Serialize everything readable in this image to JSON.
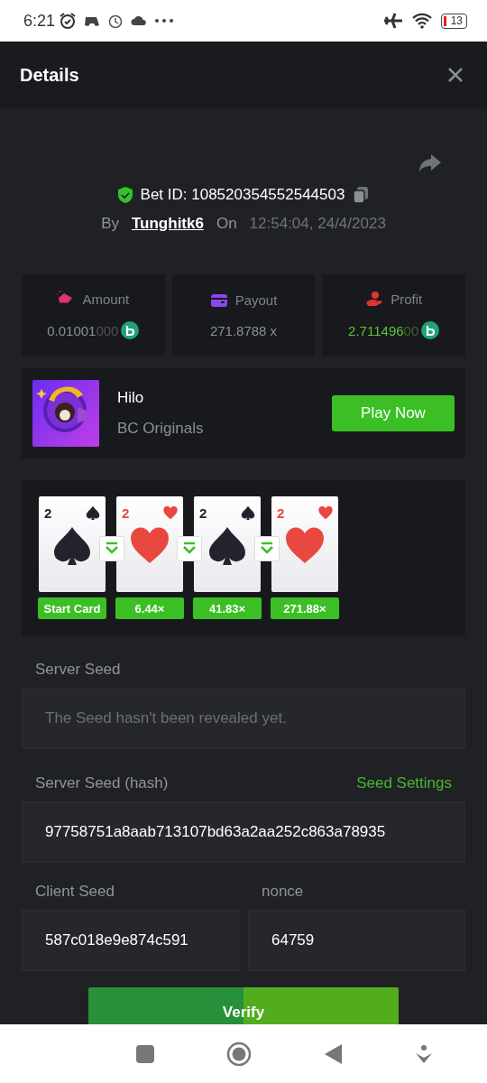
{
  "status_bar": {
    "time": "6:21",
    "battery": "13"
  },
  "header": {
    "title": "Details"
  },
  "bet": {
    "id_label": "Bet ID: 108520354552544503",
    "by_label": "By",
    "user": "Tunghitk6",
    "on_label": "On",
    "datetime": "12:54:04, 24/4/2023"
  },
  "stats": [
    {
      "kind": "amount",
      "label": "Amount",
      "value": "0.01001",
      "trailing": "000",
      "coin": true
    },
    {
      "kind": "payout",
      "label": "Payout",
      "value": "271.8788 x",
      "coin": false
    },
    {
      "kind": "profit",
      "label": "Profit",
      "value": "2.711496",
      "trailing": "00",
      "coin": true
    }
  ],
  "game": {
    "name": "Hilo",
    "provider": "BC Originals",
    "button": "Play Now"
  },
  "cards": [
    {
      "rank": "2",
      "kind": "spade",
      "label": "Start Card"
    },
    {
      "rank": "2",
      "kind": "heart",
      "label": "6.44×"
    },
    {
      "rank": "2",
      "kind": "spade",
      "label": "41.83×"
    },
    {
      "rank": "2",
      "kind": "heart",
      "label": "271.88×"
    }
  ],
  "server_seed": {
    "label": "Server Seed",
    "placeholder": "The Seed hasn't been revealed yet."
  },
  "server_seed_hash": {
    "label": "Server Seed (hash)",
    "link": "Seed Settings",
    "value": "97758751a8aab713107bd63a2aa252c863a78935"
  },
  "client_seed": {
    "label": "Client Seed",
    "value": "587c018e9e874c591"
  },
  "nonce": {
    "label": "nonce",
    "value": "64759"
  },
  "verify_button": "Verify"
}
